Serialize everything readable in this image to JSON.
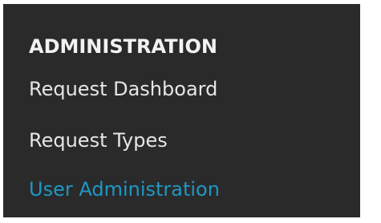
{
  "menu": {
    "heading": "ADMINISTRATION",
    "items": [
      {
        "label": "Request Dashboard",
        "active": false
      },
      {
        "label": "Request Types",
        "active": false
      },
      {
        "label": "User Administration",
        "active": true
      }
    ]
  },
  "colors": {
    "panel_background": "#2a2a2a",
    "heading_text": "#f2f2f2",
    "item_text": "#e6e6e6",
    "active_item_text": "#1f97c4"
  }
}
